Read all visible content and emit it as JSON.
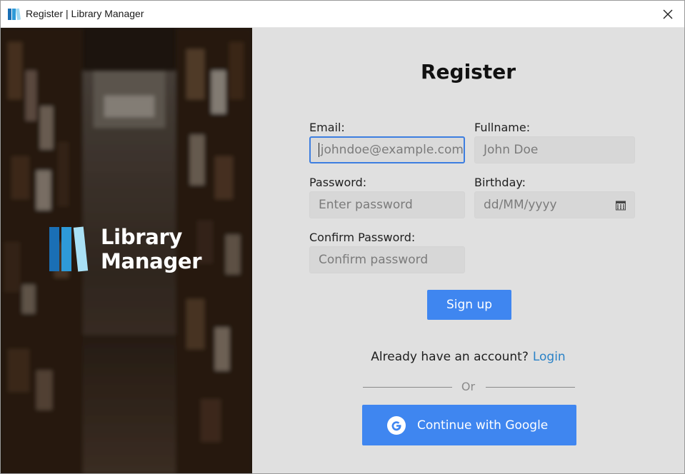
{
  "window": {
    "title": "Register | Library Manager"
  },
  "brand": {
    "line1": "Library",
    "line2": "Manager"
  },
  "form": {
    "heading": "Register",
    "email_label": "Email:",
    "email_placeholder": "johndoe@example.com",
    "fullname_label": "Fullname:",
    "fullname_placeholder": "John Doe",
    "password_label": "Password:",
    "password_placeholder": "Enter password",
    "birthday_label": "Birthday:",
    "birthday_placeholder": "dd/MM/yyyy",
    "confirm_label": "Confirm Password:",
    "confirm_placeholder": "Confirm password",
    "signup_label": "Sign up"
  },
  "footer": {
    "account_prompt": "Already have an account?",
    "login_label": "Login",
    "or_text": "Or",
    "google_label": "Continue with Google"
  },
  "colors": {
    "accent": "#3f86f0",
    "link": "#2a82c7",
    "focus_border": "#3d7ee0"
  },
  "icons": {
    "app": "library-books-icon",
    "close": "close-icon",
    "calendar": "calendar-icon",
    "google": "google-icon"
  }
}
